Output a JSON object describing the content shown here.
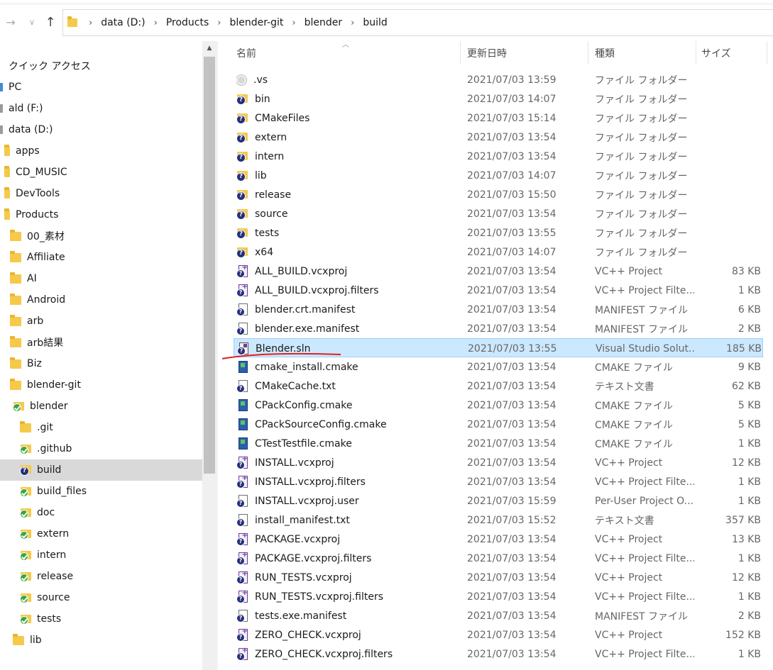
{
  "address_bar": {
    "crumbs": [
      "data (D:)",
      "Products",
      "blender-git",
      "blender",
      "build"
    ]
  },
  "nav_pane": {
    "items": [
      {
        "label": "クイック アクセス",
        "icon": "quick-access-icon",
        "indent": 0
      },
      {
        "label": "PC",
        "icon": "pc-icon",
        "indent": 0
      },
      {
        "label": "ald (F:)",
        "icon": "drive-icon",
        "indent": 0
      },
      {
        "label": "data (D:)",
        "icon": "drive-icon",
        "indent": 0
      },
      {
        "label": "apps",
        "icon": "folder-icon",
        "indent": 1
      },
      {
        "label": "CD_MUSIC",
        "icon": "folder-icon",
        "indent": 1
      },
      {
        "label": "DevTools",
        "icon": "folder-icon",
        "indent": 1
      },
      {
        "label": "Products",
        "icon": "folder-icon",
        "indent": 1
      },
      {
        "label": "00_素材",
        "icon": "folder-icon",
        "indent": 2
      },
      {
        "label": "Affiliate",
        "icon": "folder-icon",
        "indent": 2
      },
      {
        "label": "AI",
        "icon": "folder-icon",
        "indent": 2
      },
      {
        "label": "Android",
        "icon": "folder-icon",
        "indent": 2
      },
      {
        "label": "arb",
        "icon": "folder-icon",
        "indent": 2
      },
      {
        "label": "arb結果",
        "icon": "folder-icon",
        "indent": 2
      },
      {
        "label": "Biz",
        "icon": "folder-icon",
        "indent": 2
      },
      {
        "label": "blender-git",
        "icon": "folder-icon",
        "indent": 2
      },
      {
        "label": "blender",
        "icon": "git-folder-icon",
        "indent": 3
      },
      {
        "label": ".git",
        "icon": "folder-icon",
        "indent": 4
      },
      {
        "label": ".github",
        "icon": "git-folder-icon",
        "indent": 4
      },
      {
        "label": "build",
        "icon": "question-folder-icon",
        "indent": 4,
        "selected": true
      },
      {
        "label": "build_files",
        "icon": "git-folder-icon",
        "indent": 4
      },
      {
        "label": "doc",
        "icon": "git-folder-icon",
        "indent": 4
      },
      {
        "label": "extern",
        "icon": "git-folder-icon",
        "indent": 4
      },
      {
        "label": "intern",
        "icon": "git-folder-icon",
        "indent": 4
      },
      {
        "label": "release",
        "icon": "git-folder-icon",
        "indent": 4
      },
      {
        "label": "source",
        "icon": "git-folder-icon",
        "indent": 4
      },
      {
        "label": "tests",
        "icon": "git-folder-icon",
        "indent": 4
      },
      {
        "label": "lib",
        "icon": "folder-icon",
        "indent": 3
      }
    ]
  },
  "columns": {
    "name": "名前",
    "date": "更新日時",
    "type": "種類",
    "size": "サイズ"
  },
  "files": [
    {
      "name": ".vs",
      "date": "2021/07/03 13:59",
      "type": "ファイル フォルダー",
      "size": "",
      "icon": "gray-folder-icon"
    },
    {
      "name": "bin",
      "date": "2021/07/03 14:07",
      "type": "ファイル フォルダー",
      "size": "",
      "icon": "question-folder-icon"
    },
    {
      "name": "CMakeFiles",
      "date": "2021/07/03 15:14",
      "type": "ファイル フォルダー",
      "size": "",
      "icon": "question-folder-icon"
    },
    {
      "name": "extern",
      "date": "2021/07/03 13:54",
      "type": "ファイル フォルダー",
      "size": "",
      "icon": "question-folder-icon"
    },
    {
      "name": "intern",
      "date": "2021/07/03 13:54",
      "type": "ファイル フォルダー",
      "size": "",
      "icon": "question-folder-icon"
    },
    {
      "name": "lib",
      "date": "2021/07/03 14:07",
      "type": "ファイル フォルダー",
      "size": "",
      "icon": "question-folder-icon"
    },
    {
      "name": "release",
      "date": "2021/07/03 15:50",
      "type": "ファイル フォルダー",
      "size": "",
      "icon": "question-folder-icon"
    },
    {
      "name": "source",
      "date": "2021/07/03 13:54",
      "type": "ファイル フォルダー",
      "size": "",
      "icon": "question-folder-icon"
    },
    {
      "name": "tests",
      "date": "2021/07/03 13:55",
      "type": "ファイル フォルダー",
      "size": "",
      "icon": "question-folder-icon"
    },
    {
      "name": "x64",
      "date": "2021/07/03 14:07",
      "type": "ファイル フォルダー",
      "size": "",
      "icon": "question-folder-icon"
    },
    {
      "name": "ALL_BUILD.vcxproj",
      "date": "2021/07/03 13:54",
      "type": "VC++ Project",
      "size": "83 KB",
      "icon": "vcxproj-file-icon"
    },
    {
      "name": "ALL_BUILD.vcxproj.filters",
      "date": "2021/07/03 13:54",
      "type": "VC++ Project Filte...",
      "size": "1 KB",
      "icon": "vcxproj-file-icon"
    },
    {
      "name": "blender.crt.manifest",
      "date": "2021/07/03 13:54",
      "type": "MANIFEST ファイル",
      "size": "6 KB",
      "icon": "manifest-file-icon"
    },
    {
      "name": "blender.exe.manifest",
      "date": "2021/07/03 13:54",
      "type": "MANIFEST ファイル",
      "size": "2 KB",
      "icon": "manifest-file-icon"
    },
    {
      "name": "Blender.sln",
      "date": "2021/07/03 13:55",
      "type": "Visual Studio Solut...",
      "size": "185 KB",
      "icon": "sln-file-icon",
      "selected": true
    },
    {
      "name": "cmake_install.cmake",
      "date": "2021/07/03 13:54",
      "type": "CMAKE ファイル",
      "size": "9 KB",
      "icon": "cmake-file-icon"
    },
    {
      "name": "CMakeCache.txt",
      "date": "2021/07/03 13:54",
      "type": "テキスト文書",
      "size": "62 KB",
      "icon": "text-file-icon"
    },
    {
      "name": "CPackConfig.cmake",
      "date": "2021/07/03 13:54",
      "type": "CMAKE ファイル",
      "size": "5 KB",
      "icon": "cmake-file-icon"
    },
    {
      "name": "CPackSourceConfig.cmake",
      "date": "2021/07/03 13:54",
      "type": "CMAKE ファイル",
      "size": "5 KB",
      "icon": "cmake-file-icon"
    },
    {
      "name": "CTestTestfile.cmake",
      "date": "2021/07/03 13:54",
      "type": "CMAKE ファイル",
      "size": "1 KB",
      "icon": "cmake-file-icon"
    },
    {
      "name": "INSTALL.vcxproj",
      "date": "2021/07/03 13:54",
      "type": "VC++ Project",
      "size": "12 KB",
      "icon": "vcxproj-file-icon"
    },
    {
      "name": "INSTALL.vcxproj.filters",
      "date": "2021/07/03 13:54",
      "type": "VC++ Project Filte...",
      "size": "1 KB",
      "icon": "vcxproj-file-icon"
    },
    {
      "name": "INSTALL.vcxproj.user",
      "date": "2021/07/03 15:59",
      "type": "Per-User Project O...",
      "size": "1 KB",
      "icon": "text-file-icon"
    },
    {
      "name": "install_manifest.txt",
      "date": "2021/07/03 15:52",
      "type": "テキスト文書",
      "size": "357 KB",
      "icon": "text-file-icon"
    },
    {
      "name": "PACKAGE.vcxproj",
      "date": "2021/07/03 13:54",
      "type": "VC++ Project",
      "size": "13 KB",
      "icon": "vcxproj-file-icon"
    },
    {
      "name": "PACKAGE.vcxproj.filters",
      "date": "2021/07/03 13:54",
      "type": "VC++ Project Filte...",
      "size": "1 KB",
      "icon": "vcxproj-file-icon"
    },
    {
      "name": "RUN_TESTS.vcxproj",
      "date": "2021/07/03 13:54",
      "type": "VC++ Project",
      "size": "12 KB",
      "icon": "vcxproj-file-icon"
    },
    {
      "name": "RUN_TESTS.vcxproj.filters",
      "date": "2021/07/03 13:54",
      "type": "VC++ Project Filte...",
      "size": "1 KB",
      "icon": "vcxproj-file-icon"
    },
    {
      "name": "tests.exe.manifest",
      "date": "2021/07/03 13:54",
      "type": "MANIFEST ファイル",
      "size": "2 KB",
      "icon": "manifest-file-icon"
    },
    {
      "name": "ZERO_CHECK.vcxproj",
      "date": "2021/07/03 13:54",
      "type": "VC++ Project",
      "size": "152 KB",
      "icon": "vcxproj-file-icon"
    },
    {
      "name": "ZERO_CHECK.vcxproj.filters",
      "date": "2021/07/03 13:54",
      "type": "VC++ Project Filte...",
      "size": "1 KB",
      "icon": "vcxproj-file-icon"
    }
  ],
  "colors": {
    "selection_bg": "#cce8ff",
    "selection_border": "#99d1ff",
    "nav_selection_bg": "#d9d9d9",
    "annotation_red": "#e0201f"
  }
}
